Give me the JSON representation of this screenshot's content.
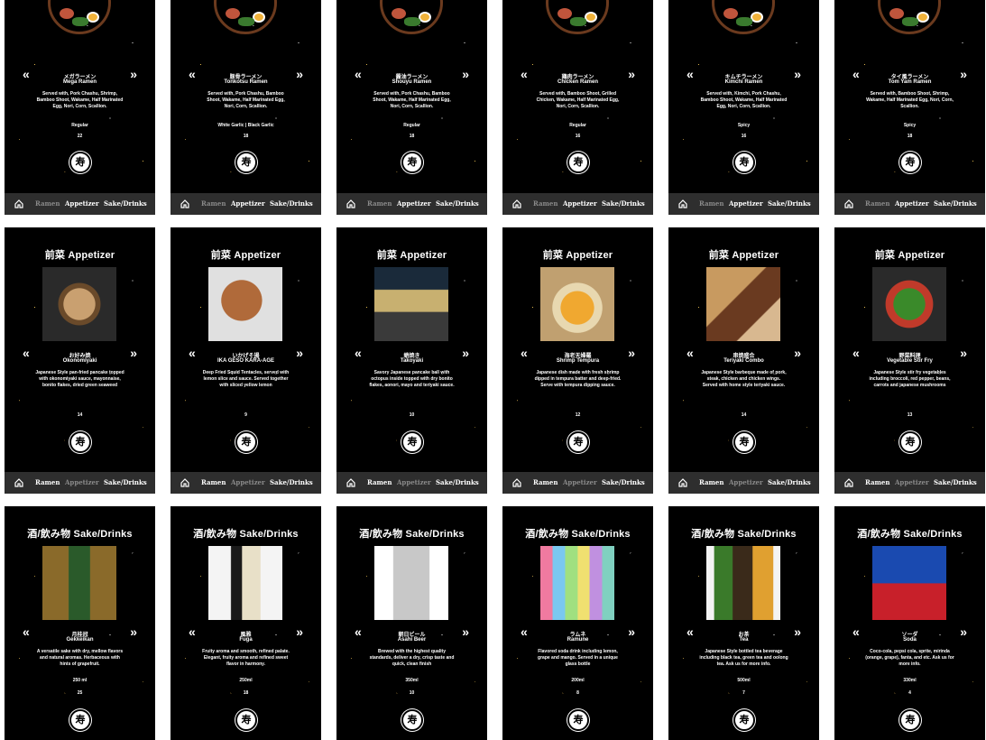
{
  "nav": {
    "ramen": "Ramen",
    "appetizer": "Appetizer",
    "drinks": "Sake/Drinks"
  },
  "sections": {
    "appetizer_heading": "前菜 Appetizer",
    "drinks_heading": "酒/飲み物 Sake/Drinks"
  },
  "ramen": [
    {
      "jp": "メガラーメン",
      "en": "Mega Ramen",
      "desc": "Served with, Pork Chashu, Shrimp, Bamboo Shoot, Wakame, Half Marinated Egg, Nori, Corn, Scallion.",
      "option": "Regular",
      "price": "22"
    },
    {
      "jp": "豚骨ラーメン",
      "en": "Tonkotsu Ramen",
      "desc": "Served with, Pork Chashu, Bamboo Shoot, Wakame, Half Marinated Egg, Nori, Corn, Scallion.",
      "option": "White Garlic | Black Garlic",
      "price": "18"
    },
    {
      "jp": "醤油ラーメン",
      "en": "Shouyu Ramen",
      "desc": "Served with, Pork Chashu, Bamboo Shoot, Wakame, Half Marinated Egg, Nori, Corn, Scallion.",
      "option": "Regular",
      "price": "18"
    },
    {
      "jp": "鶏肉ラーメン",
      "en": "Chicken Ramen",
      "desc": "Served with, Bamboo Shoot, Grilled Chicken, Wakame, Half Marinated Egg, Nori, Corn, Scallion.",
      "option": "Regular",
      "price": "16"
    },
    {
      "jp": "キムチラーメン",
      "en": "Kimchi Ramen",
      "desc": "Served with, Kimchi, Pork Chashu, Bamboo Shoot, Wakame, Half Marinated Egg, Nori, Corn, Scallion.",
      "option": "Spicy",
      "price": "16"
    },
    {
      "jp": "タイ風ラーメン",
      "en": "Tom Yam Ramen",
      "desc": "Served with, Bamboo Shoot, Shrimp, Wakame, Half Marinated Egg, Nori, Corn, Scallion.",
      "option": "Spicy",
      "price": "18"
    }
  ],
  "appetizers": [
    {
      "jp": "お好み焼",
      "en": "Okonomiyaki",
      "desc": "Japanese Style pan-fried pancake topped with okonomiyaki sauce, mayonnaise, bonito flakes, dried green seaweed",
      "price": "14"
    },
    {
      "jp": "いかげそ揚",
      "en": "IKA GESO KARA-AGE",
      "desc": "Deep Fried Squid Tentacles, served with lemon slice and sauce. Served together with sliced yellow lemon",
      "price": "9"
    },
    {
      "jp": "蛸焼き",
      "en": "Takoyaki",
      "desc": "Savory Japanese pancake ball with octopus inside topped with dry bonito flakes, aonori, mayo and teriyaki sauce.",
      "price": "10"
    },
    {
      "jp": "海老天婦羅",
      "en": "Shrimp Tempura",
      "desc": "Japanese dish made with fresh shrimp dipped in tempura batter and deep-fried. Serve with tempura dipping sauce.",
      "price": "12"
    },
    {
      "jp": "串焼盛合",
      "en": "Teriyaki Combo",
      "desc": "Japanese Style barbeque made of pork, steak, chicken and chicken wings. Served with home style teriyaki sauce.",
      "price": "14"
    },
    {
      "jp": "野菜料理",
      "en": "Vegetable Stir Fry",
      "desc": "Japanese Style stir fry vegetables including broccoli, red pepper, beans, carrots and japanese mushrooms",
      "price": "13"
    }
  ],
  "drinks": [
    {
      "jp": "月桂冠",
      "en": "Gekkeikan",
      "desc": "A versatile sake with dry, mellow flavors and natural aromas. Herbaceous with hints of grapefruit.",
      "size": "250 ml",
      "price": "25"
    },
    {
      "jp": "風雅",
      "en": "Fuga",
      "desc": "Fruity aroma and smooth, refined palate. Elegant, fruity aroma and refined sweet flavor in harmony.",
      "size": "250ml",
      "price": "18"
    },
    {
      "jp": "朝日ビール",
      "en": "Asahi Beer",
      "desc": "Brewed with the highest quality standards, deliver a dry, crisp taste and quick, clean finish",
      "size": "350ml",
      "price": "10"
    },
    {
      "jp": "ラムネ",
      "en": "Ramune",
      "desc": "Flavored soda drink including lemon, grape and mango. Served in a unique glass bottle",
      "size": "200ml",
      "price": "8"
    },
    {
      "jp": "お茶",
      "en": "Tea",
      "desc": "Japanese Style bottled tea beverage including black tea, green tea and oolong tea. Ask us for more info.",
      "size": "500ml",
      "price": "7"
    },
    {
      "jp": "ソーダ",
      "en": "Soda",
      "desc": "Coco-cola, pepsi cola, sprite, mirinda (orange, grape), fanta, and etc. Ask us for more info.",
      "size": "330ml",
      "price": "4"
    }
  ],
  "colors": {
    "bg": "#000000",
    "navbar": "#2e2e2e",
    "active_nav": "#8a8a8a",
    "text": "#ffffff"
  },
  "icons": {
    "home": "home-icon",
    "prev": "double-chevron-left-icon",
    "next": "double-chevron-right-icon",
    "logo": "restaurant-logo"
  }
}
